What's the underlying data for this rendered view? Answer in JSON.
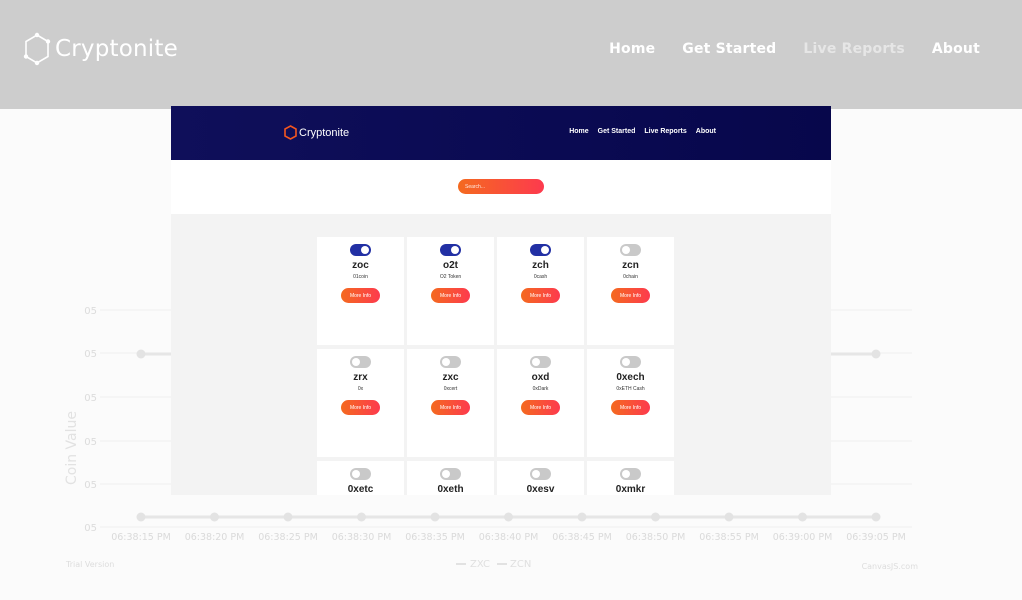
{
  "outer": {
    "brand": "Cryptonite",
    "nav": [
      {
        "label": "Home",
        "active": false
      },
      {
        "label": "Get Started",
        "active": false
      },
      {
        "label": "Live Reports",
        "active": true
      },
      {
        "label": "About",
        "active": false
      }
    ]
  },
  "chart": {
    "ylabel": "Coin Value",
    "ytick_label": "05",
    "x_ticks": [
      "06:38:15 PM",
      "06:38:20 PM",
      "06:38:25 PM",
      "06:38:30 PM",
      "06:38:35 PM",
      "06:38:40 PM",
      "06:38:45 PM",
      "06:38:50 PM",
      "06:38:55 PM",
      "06:39:00 PM",
      "06:39:05 PM"
    ],
    "legend": [
      "ZXC",
      "ZCN"
    ],
    "credit_left": "Trial Version",
    "credit_right": "CanvasJS.com"
  },
  "inner": {
    "brand": "Cryptonite",
    "nav": [
      "Home",
      "Get Started",
      "Live Reports",
      "About"
    ],
    "search_placeholder": "Search...",
    "more_info_label": "More Info",
    "coins": [
      {
        "symbol": "zoc",
        "name": "01coin",
        "selected": true
      },
      {
        "symbol": "o2t",
        "name": "O2 Token",
        "selected": true
      },
      {
        "symbol": "zch",
        "name": "0cash",
        "selected": true
      },
      {
        "symbol": "zcn",
        "name": "0chain",
        "selected": false
      },
      {
        "symbol": "zrx",
        "name": "0x",
        "selected": false
      },
      {
        "symbol": "zxc",
        "name": "0xcert",
        "selected": false
      },
      {
        "symbol": "oxd",
        "name": "0xDark",
        "selected": false
      },
      {
        "symbol": "0xech",
        "name": "0xETH Cash",
        "selected": false
      },
      {
        "symbol": "0xetc",
        "name": "",
        "selected": false
      },
      {
        "symbol": "0xeth",
        "name": "",
        "selected": false
      },
      {
        "symbol": "0xesv",
        "name": "",
        "selected": false
      },
      {
        "symbol": "0xmkr",
        "name": "",
        "selected": false
      }
    ]
  },
  "colors": {
    "accent_gradient_start": "#f46a1f",
    "accent_gradient_end": "#fd3a4e",
    "toggle_on": "#2230a4",
    "inner_header": "#0f0f5a"
  }
}
